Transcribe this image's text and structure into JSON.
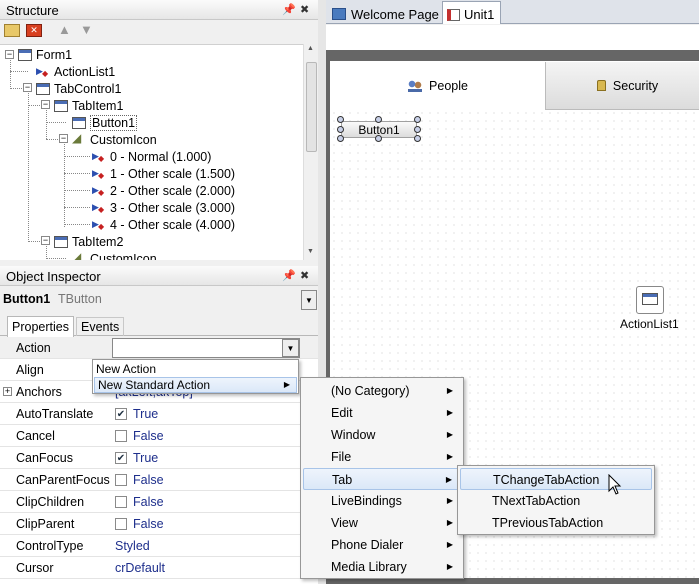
{
  "structure": {
    "title": "Structure",
    "nodes": [
      {
        "label": "Form1"
      },
      {
        "label": "ActionList1"
      },
      {
        "label": "TabControl1"
      },
      {
        "label": "TabItem1"
      },
      {
        "label": "Button1"
      },
      {
        "label": "CustomIcon"
      },
      {
        "label": "0 - Normal (1.000)"
      },
      {
        "label": "1 - Other scale (1.500)"
      },
      {
        "label": "2 - Other scale (2.000)"
      },
      {
        "label": "3 - Other scale (3.000)"
      },
      {
        "label": "4 - Other scale (4.000)"
      },
      {
        "label": "TabItem2"
      },
      {
        "label": "CustomIcon"
      }
    ]
  },
  "inspector": {
    "title": "Object Inspector",
    "object_name": "Button1",
    "object_type": "TButton",
    "tabs": [
      "Properties",
      "Events"
    ],
    "properties": [
      {
        "name": "Action",
        "value": ""
      },
      {
        "name": "Align",
        "value": ""
      },
      {
        "name": "Anchors",
        "value": "[akLeft,akTop]"
      },
      {
        "name": "AutoTranslate",
        "value": "True",
        "checked": true
      },
      {
        "name": "Cancel",
        "value": "False",
        "checked": false
      },
      {
        "name": "CanFocus",
        "value": "True",
        "checked": true
      },
      {
        "name": "CanParentFocus",
        "value": "False",
        "checked": false
      },
      {
        "name": "ClipChildren",
        "value": "False",
        "checked": false
      },
      {
        "name": "ClipParent",
        "value": "False",
        "checked": false
      },
      {
        "name": "ControlType",
        "value": "Styled"
      },
      {
        "name": "Cursor",
        "value": "crDefault"
      }
    ]
  },
  "editor_tabs": [
    {
      "label": "Welcome Page"
    },
    {
      "label": "Unit1"
    }
  ],
  "designer": {
    "tab_people": "People",
    "tab_security": "Security",
    "button_label": "Button1",
    "component_label": "ActionList1"
  },
  "action_menu": [
    "New Action",
    "New Standard Action"
  ],
  "category_menu": [
    "(No Category)",
    "Edit",
    "Window",
    "File",
    "Tab",
    "LiveBindings",
    "View",
    "Phone Dialer",
    "Media Library"
  ],
  "tab_actions": [
    "TChangeTabAction",
    "TNextTabAction",
    "TPreviousTabAction"
  ],
  "colors": {
    "highlight": "#dbe8f8",
    "value_text": "#1e2f8c"
  }
}
